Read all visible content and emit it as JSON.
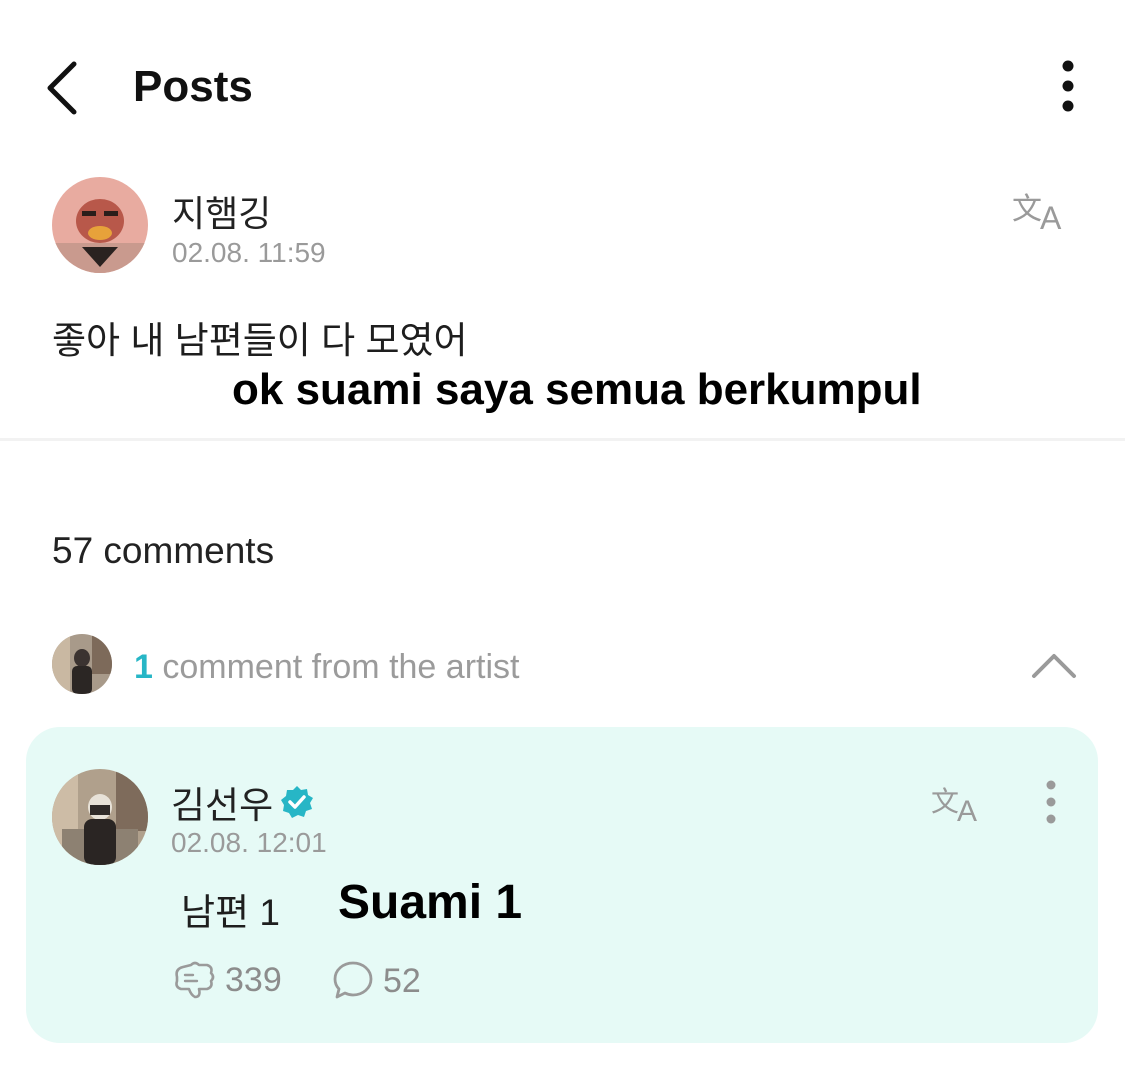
{
  "header": {
    "title": "Posts",
    "back_icon": "chevron-left-icon",
    "menu_icon": "more-vertical-icon"
  },
  "post": {
    "author": "지햄깅",
    "time": "02.08. 11:59",
    "text": "좋아 내 남편들이 다 모였어",
    "caption": "ok suami saya semua berkumpul",
    "translate_icon": "translate-icon"
  },
  "comments": {
    "count_label": "57 comments"
  },
  "artist_section": {
    "count": "1",
    "label": " comment from the artist",
    "toggle_icon": "chevron-up-icon"
  },
  "artist_comment": {
    "author": "김선우",
    "verified_icon": "verified-badge-icon",
    "time": "02.08. 12:01",
    "text": "남편 1",
    "caption": "Suami 1",
    "likes": "339",
    "replies": "52",
    "colors": {
      "card_bg": "#e6faf6",
      "accent": "#27b6c6"
    }
  }
}
